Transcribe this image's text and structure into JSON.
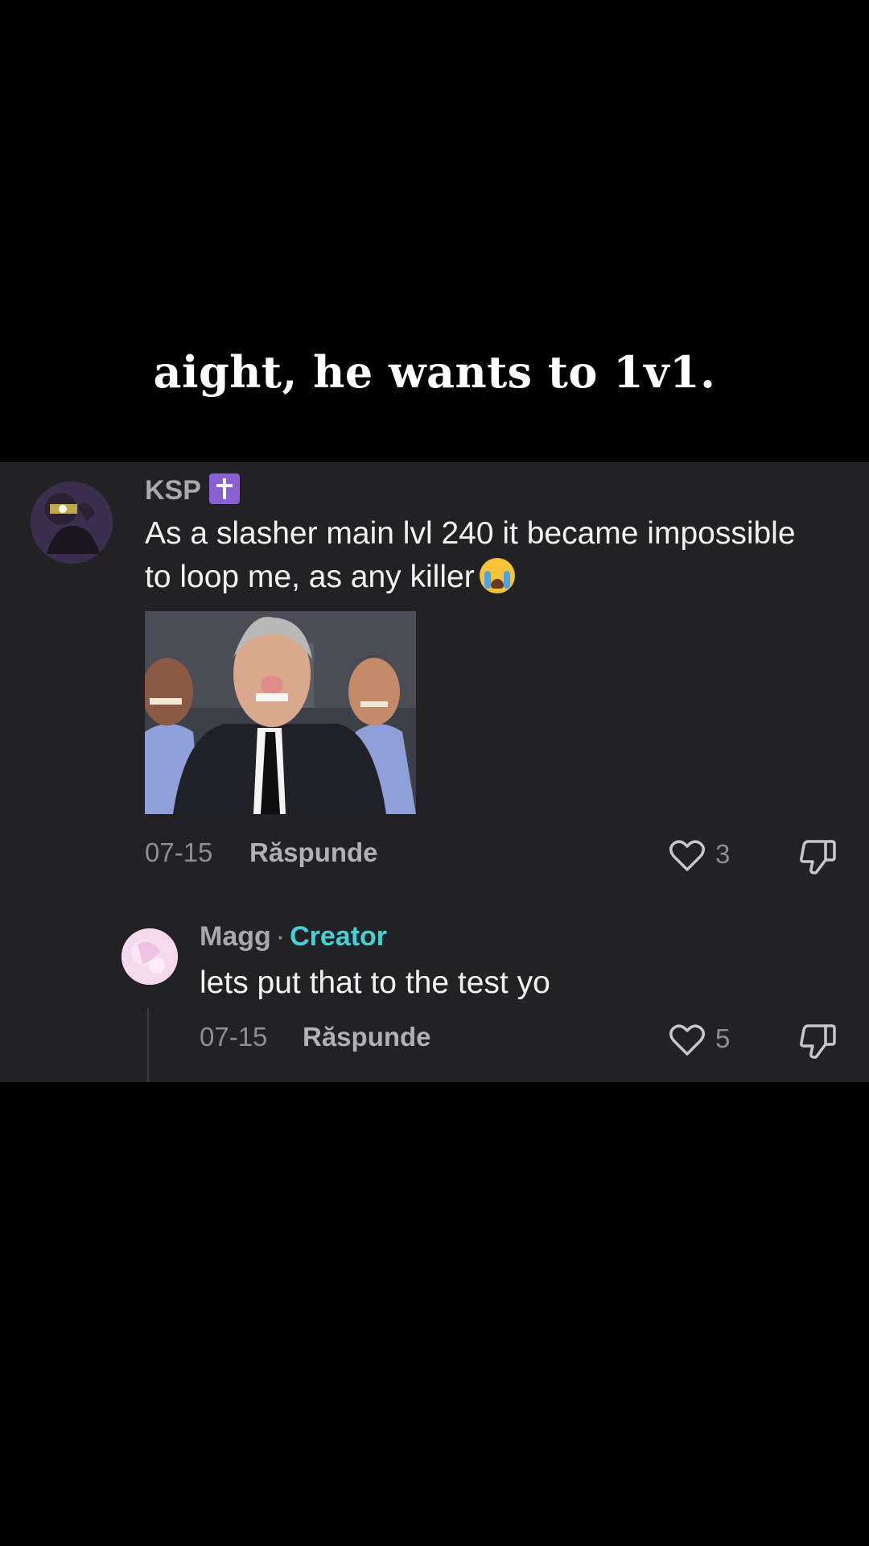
{
  "caption": "aight, he wants to 1v1.",
  "comment": {
    "username": "KSP",
    "badge_icon": "latin-cross-icon",
    "text": "As a slasher main lvl 240 it became impossible to loop me, as any killer",
    "emoji": "loudly-crying-face-emoji",
    "date": "07-15",
    "reply_label": "Răspunde",
    "likes": "3"
  },
  "reply": {
    "username": "Magg",
    "separator": "·",
    "creator_label": "Creator",
    "text": "lets put that to the test yo",
    "date": "07-15",
    "reply_label": "Răspunde",
    "likes": "5"
  },
  "colors": {
    "background": "#000000",
    "panel": "#222224",
    "creator_accent": "#46d1d8",
    "badge": "#8a5fd1"
  }
}
